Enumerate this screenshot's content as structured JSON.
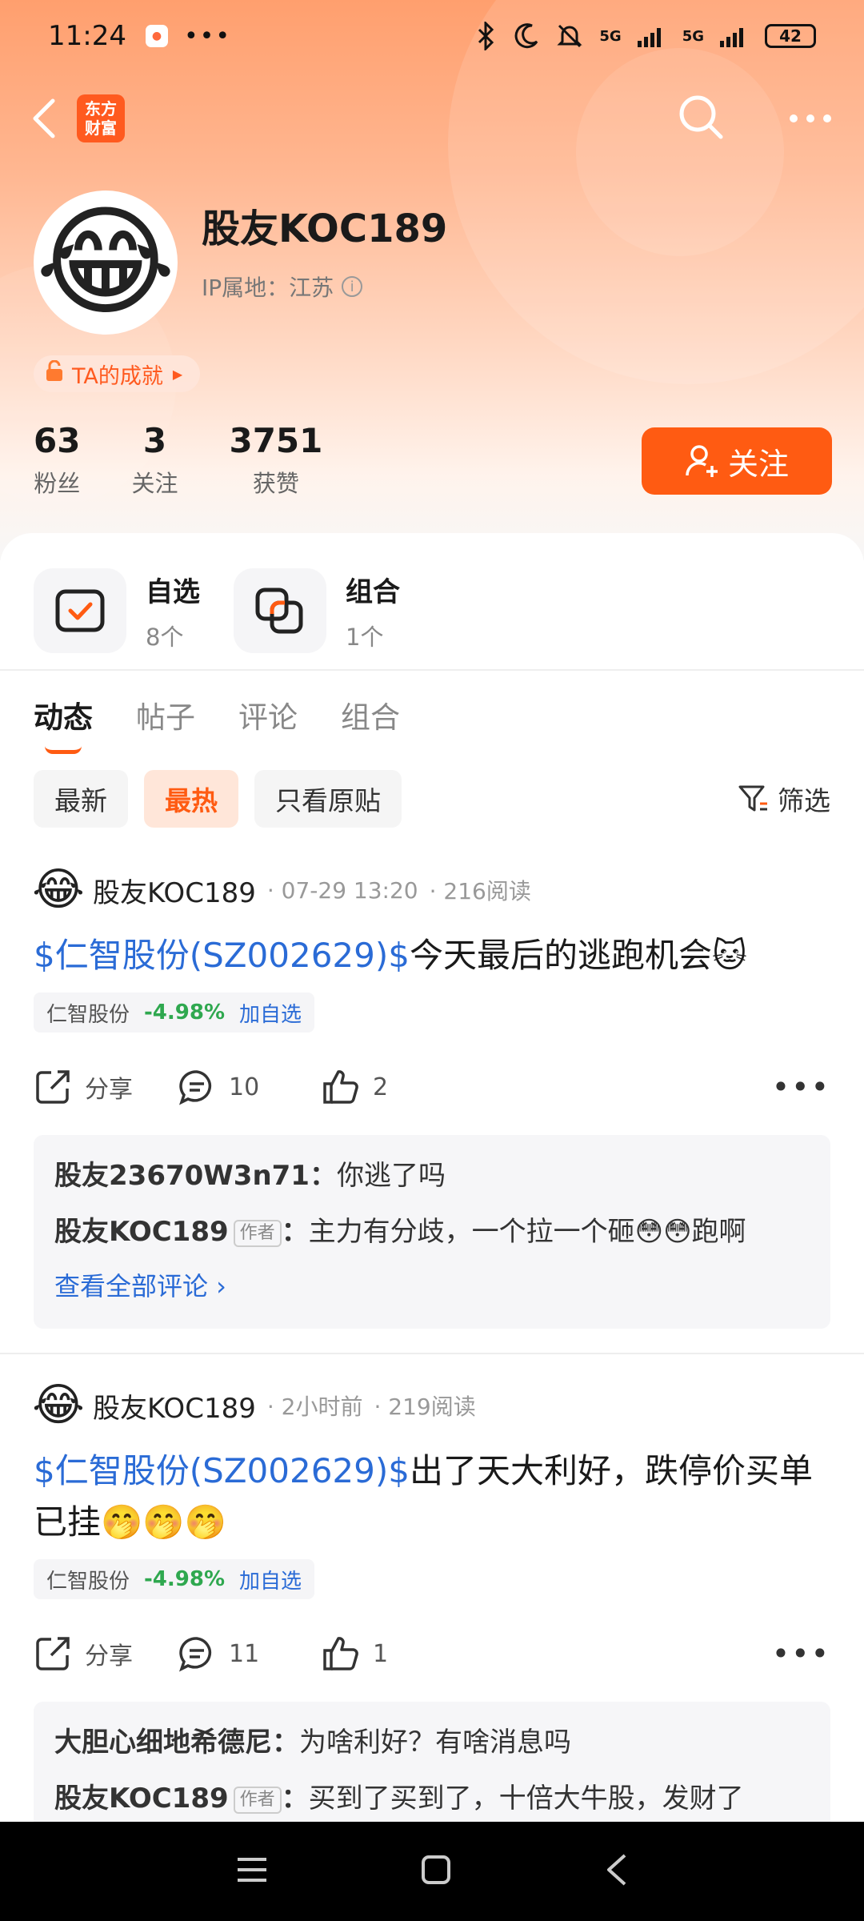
{
  "status_bar": {
    "time": "11:24",
    "dots": "•••",
    "network1": "5G",
    "network2": "5G",
    "battery": "42"
  },
  "nav": {
    "brand_line1": "东方",
    "brand_line2": "财富"
  },
  "profile": {
    "avatar": "😂",
    "username": "股友KOC189",
    "ip_location": "IP属地：江苏",
    "achievement": "TA的成就",
    "stats": [
      {
        "value": "63",
        "label": "粉丝"
      },
      {
        "value": "3",
        "label": "关注"
      },
      {
        "value": "3751",
        "label": "获赞"
      }
    ],
    "follow_label": "关注"
  },
  "quick_links": [
    {
      "title": "自选",
      "sub": "8个",
      "icon": "watchlist-icon"
    },
    {
      "title": "组合",
      "sub": "1个",
      "icon": "portfolio-icon"
    }
  ],
  "tabs": [
    "动态",
    "帖子",
    "评论",
    "组合"
  ],
  "filters": {
    "chips": [
      "最新",
      "最热",
      "只看原贴"
    ],
    "active": "最热",
    "filter_label": "筛选"
  },
  "posts": [
    {
      "avatar": "😂",
      "author": "股友KOC189",
      "time": "· 07-29 13:20",
      "reads": "· 216阅读",
      "stock_link": "$仁智股份(SZ002629)$",
      "text": "今天最后的逃跑机会🐱",
      "tag_name": "仁智股份",
      "tag_pct": "-4.98%",
      "tag_add": "加自选",
      "share": "分享",
      "comments_count": "10",
      "likes": "2",
      "comments": [
        {
          "user": "股友23670W3n71：",
          "text": "你逃了吗",
          "is_author": false
        },
        {
          "user": "股友KOC189",
          "badge": "作者",
          "sep": "：",
          "text": "主力有分歧，一个拉一个砸😳😳跑啊",
          "is_author": true
        }
      ],
      "view_all": "查看全部评论 ›"
    },
    {
      "avatar": "😂",
      "author": "股友KOC189",
      "time": "· 2小时前",
      "reads": "· 219阅读",
      "stock_link": "$仁智股份(SZ002629)$",
      "text": "出了天大利好，跌停价买单已挂🤭🤭🤭",
      "tag_name": "仁智股份",
      "tag_pct": "-4.98%",
      "tag_add": "加自选",
      "share": "分享",
      "comments_count": "11",
      "likes": "1",
      "comments": [
        {
          "user": "大胆心细地希德尼：",
          "text": "为啥利好？有啥消息吗",
          "is_author": false
        },
        {
          "user": "股友KOC189",
          "badge": "作者",
          "sep": "：",
          "text": "买到了买到了，十倍大牛股，发财了",
          "is_author": true
        }
      ]
    }
  ]
}
